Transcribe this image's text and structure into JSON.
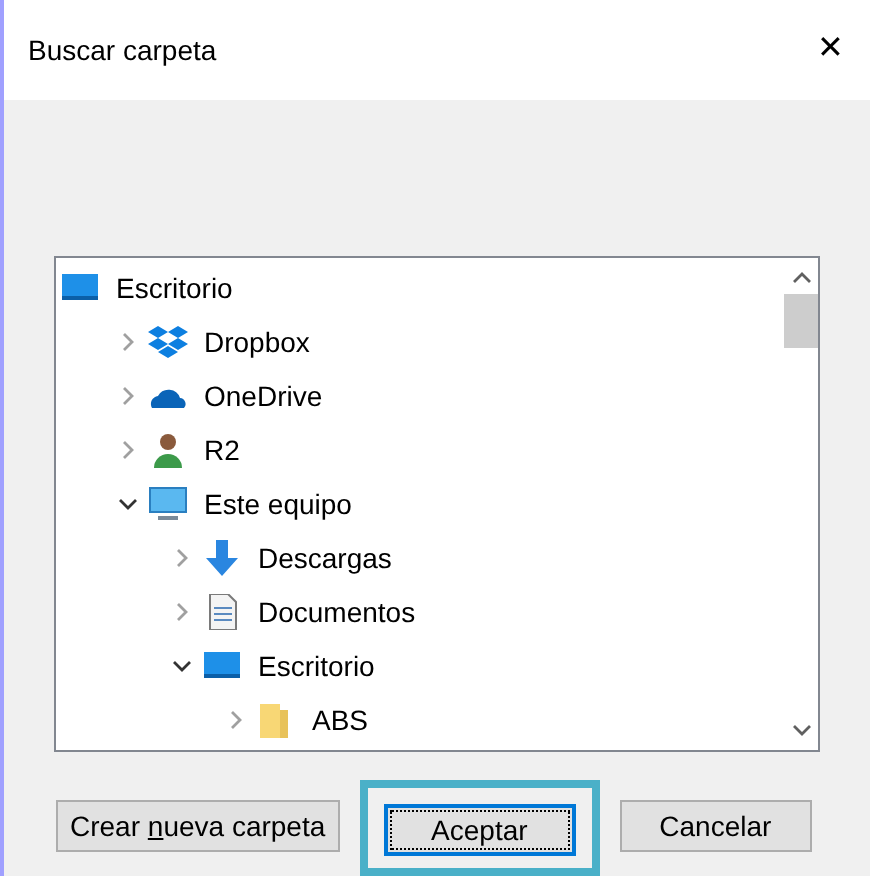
{
  "window": {
    "title": "Buscar carpeta",
    "close": "✕"
  },
  "tree": [
    {
      "label": "Escritorio",
      "kind": "desktop",
      "selected": false,
      "children": [
        {
          "label": "Dropbox",
          "kind": "dropbox",
          "expanded": false,
          "selected": false
        },
        {
          "label": "OneDrive",
          "kind": "onedrive",
          "expanded": false,
          "selected": false
        },
        {
          "label": "R2",
          "kind": "user",
          "expanded": false,
          "selected": false
        },
        {
          "label": "Este equipo",
          "kind": "pc",
          "expanded": true,
          "selected": false,
          "children": [
            {
              "label": "Descargas",
              "kind": "download",
              "expanded": false,
              "selected": false
            },
            {
              "label": "Documentos",
              "kind": "document",
              "expanded": false,
              "selected": false
            },
            {
              "label": "Escritorio",
              "kind": "desktop",
              "expanded": true,
              "selected": false,
              "children": [
                {
                  "label": "ABS",
                  "kind": "folder",
                  "expanded": false,
                  "selected": false
                }
              ]
            }
          ]
        }
      ]
    }
  ],
  "buttons": [
    {
      "before": "Crear ",
      "access_key": "n",
      "after": "ueva carpeta",
      "focused": false,
      "highlighted": false
    },
    {
      "before": "Aceptar",
      "focused": true,
      "highlighted": true
    },
    {
      "before": "Cancelar",
      "focused": false,
      "highlighted": false
    }
  ]
}
